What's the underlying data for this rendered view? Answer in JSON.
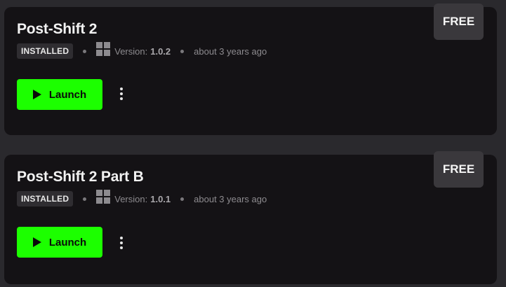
{
  "apps": [
    {
      "title": "Post-Shift 2",
      "status_badge": "INSTALLED",
      "version_label": "Version:",
      "version": "1.0.2",
      "updated": "about 3 years ago",
      "launch_label": "Launch",
      "price_badge": "FREE",
      "platform_icon": "windows-icon"
    },
    {
      "title": "Post-Shift 2 Part B",
      "status_badge": "INSTALLED",
      "version_label": "Version:",
      "version": "1.0.1",
      "updated": "about 3 years ago",
      "launch_label": "Launch",
      "price_badge": "FREE",
      "platform_icon": "windows-icon"
    }
  ],
  "colors": {
    "background": "#2a292d",
    "card": "#141215",
    "launch_button": "#1cff00",
    "badge": "#2f2d31",
    "price_badge": "#3a383c"
  }
}
